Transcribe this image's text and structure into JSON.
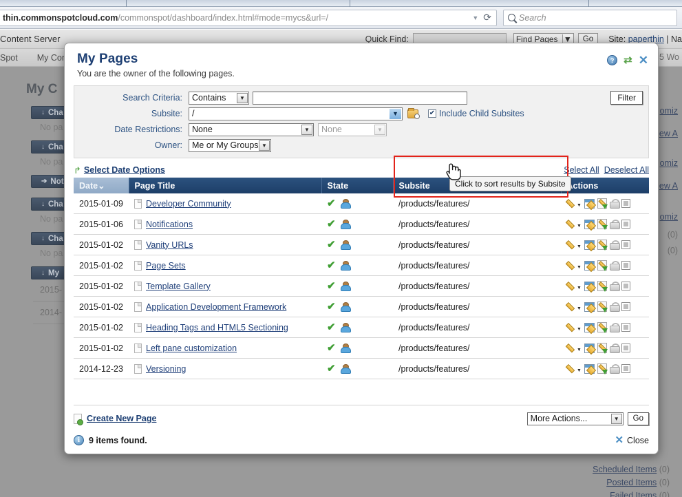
{
  "browser": {
    "url_host": "thin.commonspotcloud.com",
    "url_path": "/commonspot/dashboard/index.html#mode=mycs&url=/",
    "search_placeholder": "Search",
    "dropdown_caret": "▼",
    "reload_glyph": "⟳"
  },
  "appbar": {
    "brand": "Content Server",
    "quick_find_label": "Quick Find:",
    "quick_find_value": "",
    "find_scope": "Find Pages",
    "go_label": "Go",
    "site_prefix": "Site:",
    "site_name": "paperthin",
    "site_suffix": "| Na"
  },
  "apptabs": {
    "items": [
      "Spot",
      "My Con"
    ]
  },
  "background": {
    "page_title": "My C",
    "panels": [
      {
        "chevron": "↓",
        "label": "Cha",
        "note": "No pa"
      },
      {
        "chevron": "↓",
        "label": "Cha",
        "note": "No pa"
      },
      {
        "chevron": "➔",
        "label": "Not",
        "note": ""
      },
      {
        "chevron": "↓",
        "label": "Cha",
        "note": "No pa"
      },
      {
        "chevron": "↓",
        "label": "Cha",
        "note": "No pa"
      },
      {
        "chevron": "↓",
        "label": "My",
        "note": ""
      }
    ],
    "dates": [
      "2015-",
      "2014-"
    ],
    "right_words": [
      "5 Wo"
    ],
    "right_links": [
      {
        "label": "omiz",
        "count": ""
      },
      {
        "label": "ew A",
        "count": ""
      },
      {
        "label": "omiz",
        "count": ""
      },
      {
        "label": "ew A",
        "count": ""
      },
      {
        "label": "omiz",
        "count": ""
      },
      {
        "label": "",
        "count": "(0)"
      },
      {
        "label": "",
        "count": "(0)"
      }
    ],
    "bottom_links": [
      {
        "label": "Scheduled Items",
        "count": "(0)"
      },
      {
        "label": "Posted Items",
        "count": "(0)"
      },
      {
        "label": "Failed Items",
        "count": "(0)"
      }
    ]
  },
  "dialog": {
    "title": "My Pages",
    "subtitle": "You are the owner of the following pages.",
    "icons": {
      "help": "?",
      "refresh": "⇄",
      "close": "✕"
    },
    "filters": {
      "search_criteria_label": "Search Criteria:",
      "search_criteria_value": "Contains",
      "search_text_value": "",
      "subsite_label": "Subsite:",
      "subsite_value": "/",
      "include_child_subsites_label": "Include Child Subsites",
      "include_child_subsites_checked": "✔",
      "date_restrictions_label": "Date Restrictions:",
      "date_restriction_primary": "None",
      "date_restriction_secondary": "None",
      "owner_label": "Owner:",
      "owner_value": "Me or My Groups",
      "filter_button": "Filter",
      "caret": "▼"
    },
    "toolbar": {
      "select_date_options": "Select Date Options",
      "select_all": "Select All",
      "deselect_all": "Deselect All",
      "arrow_glyph": "↱"
    },
    "table": {
      "columns": [
        {
          "key": "date",
          "label": "Date",
          "sort_glyph": "⌄",
          "sorted": true
        },
        {
          "key": "title",
          "label": "Page Title",
          "sort_glyph": "",
          "sorted": false
        },
        {
          "key": "state",
          "label": "State",
          "sort_glyph": "",
          "sorted": false
        },
        {
          "key": "subsite",
          "label": "Subsite",
          "sort_glyph": "",
          "sorted": false
        },
        {
          "key": "actions",
          "label": "Actions",
          "sort_glyph": "",
          "sorted": false
        }
      ],
      "rows": [
        {
          "date": "2015-01-09",
          "title": "Developer Community",
          "subsite": "/products/features/"
        },
        {
          "date": "2015-01-06",
          "title": "Notifications",
          "subsite": "/products/features/"
        },
        {
          "date": "2015-01-02",
          "title": "Vanity URLs",
          "subsite": "/products/features/"
        },
        {
          "date": "2015-01-02",
          "title": "Page Sets",
          "subsite": "/products/features/"
        },
        {
          "date": "2015-01-02",
          "title": "Template Gallery",
          "subsite": "/products/features/"
        },
        {
          "date": "2015-01-02",
          "title": "Application Development Framework",
          "subsite": "/products/features/"
        },
        {
          "date": "2015-01-02",
          "title": "Heading Tags and HTML5 Sectioning",
          "subsite": "/products/features/"
        },
        {
          "date": "2015-01-02",
          "title": "Left pane customization",
          "subsite": "/products/features/"
        },
        {
          "date": "2014-12-23",
          "title": "Versioning",
          "subsite": "/products/features/"
        }
      ],
      "state_check_glyph": "✔"
    },
    "tooltip": "Click to sort results by Subsite",
    "footer": {
      "create_new_page": "Create New Page",
      "more_actions": "More Actions...",
      "go_label": "Go",
      "items_found": "9 items found.",
      "info_glyph": "i",
      "close_label": "Close",
      "close_glyph": "✕"
    }
  }
}
